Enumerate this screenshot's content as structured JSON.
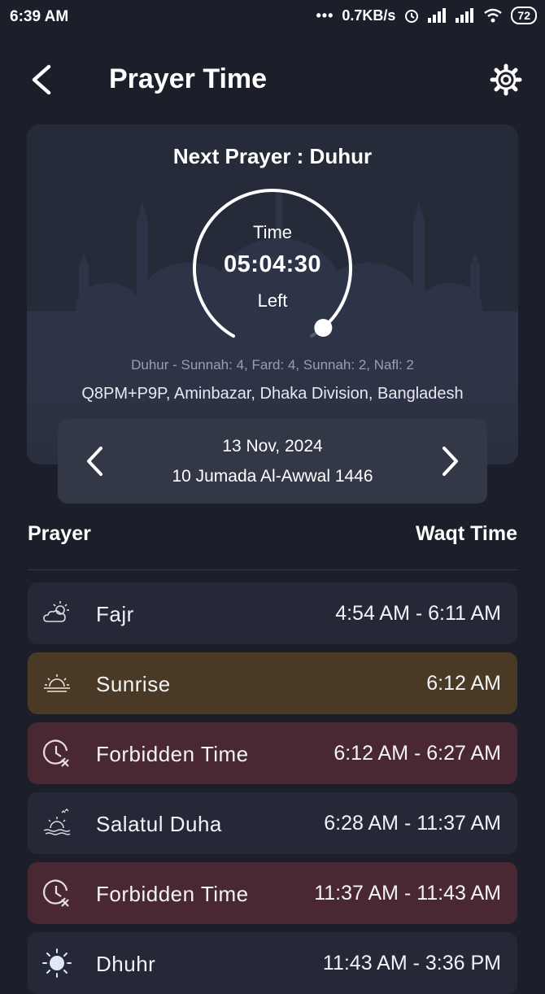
{
  "status_bar": {
    "time": "6:39 AM",
    "dots": "•••",
    "speed": "0.7KB/s",
    "battery": "72"
  },
  "header": {
    "title": "Prayer Time",
    "back_icon": "chevron-left-icon",
    "settings_icon": "gear-icon"
  },
  "next_prayer": {
    "label": "Next Prayer : Duhur",
    "time_label": "Time",
    "countdown": "05:04:30",
    "left_label": "Left",
    "progress": 0.35,
    "rakat": "Duhur - Sunnah: 4, Fard: 4, Sunnah: 2, Nafl: 2",
    "location": "Q8PM+P9P, Aminbazar, Dhaka Division, Bangladesh"
  },
  "date": {
    "gregorian": "13 Nov, 2024",
    "hijri": "10 Jumada Al-Awwal 1446"
  },
  "table": {
    "col_prayer": "Prayer",
    "col_waqt": "Waqt Time",
    "rows": [
      {
        "name": "Fajr",
        "time": "4:54 AM - 6:11 AM",
        "icon": "cloud-sun-icon",
        "style": "normal"
      },
      {
        "name": "Sunrise",
        "time": "6:12 AM",
        "icon": "sunrise-icon",
        "style": "sun"
      },
      {
        "name": "Forbidden Time",
        "time": "6:12 AM - 6:27 AM",
        "icon": "clock-forbidden-icon",
        "style": "forbid"
      },
      {
        "name": "Salatul Duha",
        "time": "6:28 AM - 11:37 AM",
        "icon": "sun-water-icon",
        "style": "normal"
      },
      {
        "name": "Forbidden Time",
        "time": "11:37 AM - 11:43 AM",
        "icon": "clock-forbidden-icon",
        "style": "forbid"
      },
      {
        "name": "Dhuhr",
        "time": "11:43 AM - 3:36 PM",
        "icon": "sun-icon",
        "style": "normal"
      }
    ]
  },
  "colors": {
    "background": "#1c1f2a",
    "card": "#262b3a",
    "sunrise_row": "#4a3a25",
    "forbidden_row": "#4a2833"
  }
}
